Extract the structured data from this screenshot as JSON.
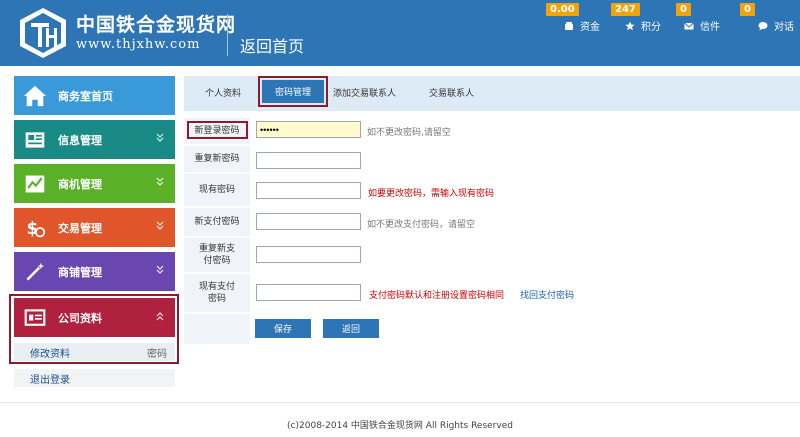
{
  "header": {
    "site_name": "中国铁合金现货网",
    "site_url": "www.thjxhw.com",
    "back_home": "返回首页",
    "stats": [
      {
        "badge": "0.00",
        "label": "资金",
        "icon": "wallet-icon"
      },
      {
        "badge": "247",
        "label": "积分",
        "icon": "star-icon"
      },
      {
        "badge": "0",
        "label": "信件",
        "icon": "mail-icon"
      },
      {
        "badge": "0",
        "label": "对话",
        "icon": "chat-icon"
      }
    ]
  },
  "sidebar": {
    "items": [
      {
        "label": "商务室首页",
        "color": "#3a9ad9",
        "icon": "home-icon"
      },
      {
        "label": "信息管理",
        "color": "#1a8a86",
        "icon": "newspaper-icon"
      },
      {
        "label": "商机管理",
        "color": "#5ab027",
        "icon": "chart-icon"
      },
      {
        "label": "交易管理",
        "color": "#e0552a",
        "icon": "dollar-icon"
      },
      {
        "label": "商铺管理",
        "color": "#6a46b0",
        "icon": "wand-icon"
      },
      {
        "label": "公司资料",
        "color": "#b0213f",
        "icon": "id-card-icon"
      }
    ],
    "sub_items": {
      "edit_profile": "修改资料",
      "password": "密码",
      "logout": "退出登录"
    }
  },
  "tabs": {
    "personal": "个人资料",
    "password": "密码管理",
    "add_contact": "添加交易联系人",
    "contacts": "交易联系人"
  },
  "form": {
    "new_login_password": {
      "label": "新登录密码",
      "value": "••••••",
      "hint": "如不更改密码,请留空"
    },
    "repeat_new_password": {
      "label": "重复新密码",
      "value": ""
    },
    "current_password": {
      "label": "现有密码",
      "value": "",
      "hint": "如要更改密码，需输入现有密码"
    },
    "new_pay_password": {
      "label": "新支付密码",
      "value": "",
      "hint": "如不更改支付密码，请留空"
    },
    "repeat_pay_password": {
      "label": "重复新支付密码",
      "value": ""
    },
    "current_pay_password": {
      "label": "现有支付密码",
      "value": "",
      "hint": "支付密码默认和注册设置密码相同",
      "link": "找回支付密码"
    },
    "save_button": "保存",
    "back_button": "返回"
  },
  "footer": {
    "copyright": "(c)2008-2014 中国铁合金现货网 All Rights Reserved"
  },
  "colors": {
    "header_bg": "#2d75b5",
    "highlight": "#8b1c2c",
    "red_hint": "#cc0000",
    "badge": "#f0a30a"
  }
}
